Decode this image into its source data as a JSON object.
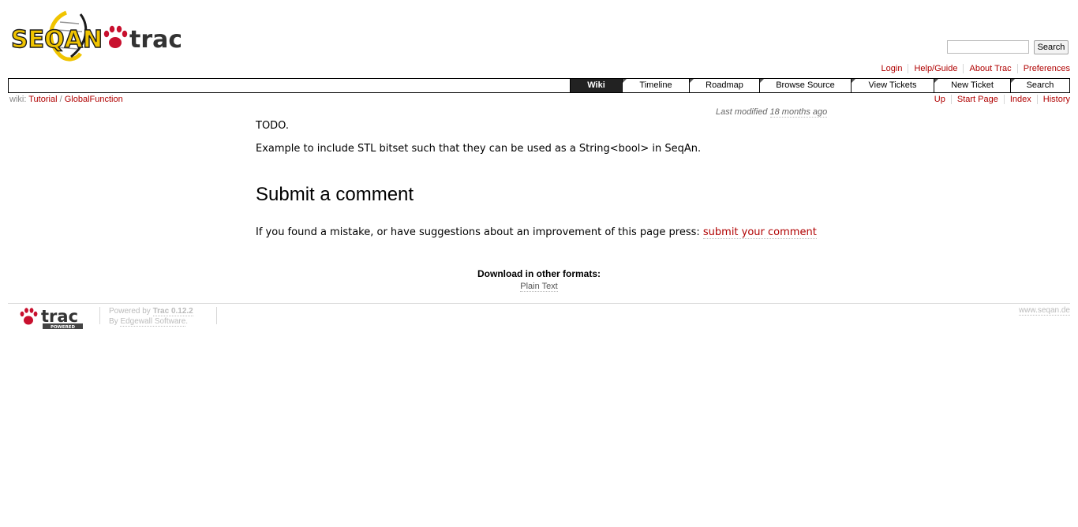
{
  "header": {
    "logo_text_seqan": "SEQAN",
    "logo_text_trac": "trac",
    "search_placeholder": "",
    "search_button": "Search"
  },
  "metanav": [
    "Login",
    "Help/Guide",
    "About Trac",
    "Preferences"
  ],
  "mainnav": {
    "tabs": [
      "Wiki",
      "Timeline",
      "Roadmap",
      "Browse Source",
      "View Tickets",
      "New Ticket",
      "Search"
    ],
    "active": "Wiki"
  },
  "breadcrumb": {
    "prefix": "wiki:",
    "items": [
      "Tutorial",
      "GlobalFunction"
    ],
    "separator": "/"
  },
  "ctxtnav": [
    "Up",
    "Start Page",
    "Index",
    "History"
  ],
  "lastmod": {
    "prefix": "Last modified",
    "age": "18 months ago"
  },
  "content": {
    "todo": "TODO.",
    "example": "Example to include STL bitset such that they can be used as a String<bool> in SeqAn.",
    "heading": "Submit a comment",
    "feedback_text": "If you found a mistake, or have suggestions about an improvement of this page press:",
    "feedback_link": "submit your comment"
  },
  "altlinks": {
    "heading": "Download in other formats:",
    "link": "Plain Text"
  },
  "footer": {
    "logo_text": "trac",
    "logo_badge": "POWERED",
    "powered_prefix": "Powered by",
    "trac_version": "Trac 0.12.2",
    "by_prefix": "By",
    "vendor": "Edgewall Software",
    "site": "www.seqan.de"
  },
  "colors": {
    "link": "#b00000",
    "logo_yellow": "#f0c400",
    "active_tab_bg": "#222222"
  }
}
